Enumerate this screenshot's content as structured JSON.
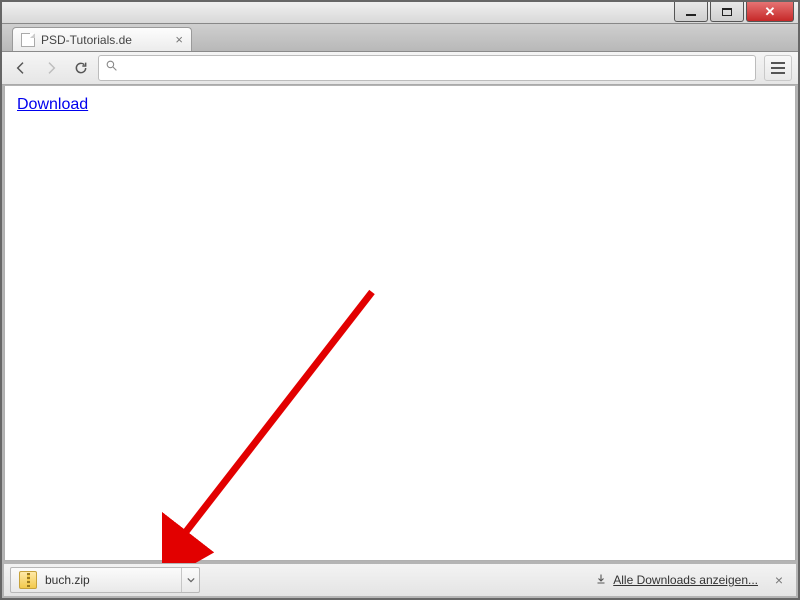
{
  "window": {
    "minimize_label": "Minimieren",
    "maximize_label": "Maximieren",
    "close_label": "Schließen"
  },
  "tab": {
    "title": "PSD-Tutorials.de"
  },
  "toolbar": {
    "omnibox_value": ""
  },
  "page": {
    "download_link_text": "Download"
  },
  "downloads_bar": {
    "file_name": "buch.zip",
    "show_all_label": "Alle Downloads anzeigen..."
  }
}
